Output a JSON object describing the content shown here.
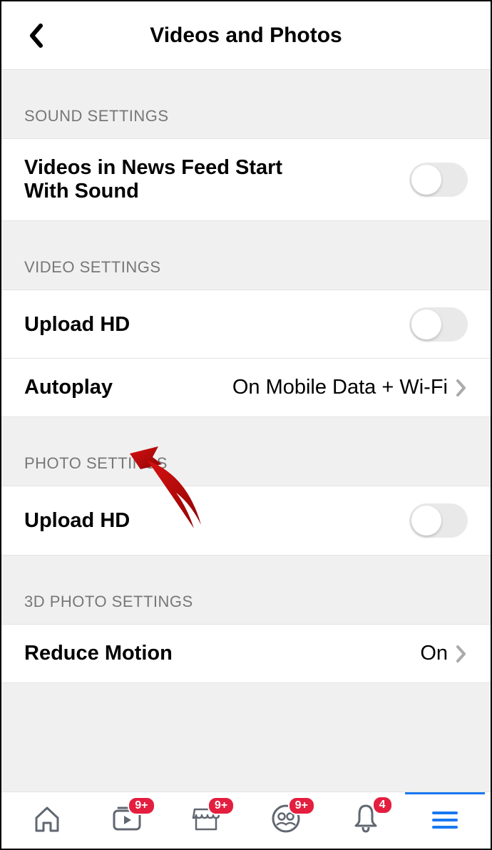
{
  "header": {
    "title": "Videos and Photos"
  },
  "sections": {
    "sound": {
      "header": "SOUND SETTINGS",
      "video_sound": {
        "label": "Videos in News Feed Start With Sound",
        "on": false
      }
    },
    "video": {
      "header": "VIDEO SETTINGS",
      "upload_hd": {
        "label": "Upload HD",
        "on": false
      },
      "autoplay": {
        "label": "Autoplay",
        "value": "On Mobile Data + Wi-Fi"
      }
    },
    "photo": {
      "header": "PHOTO SETTINGS",
      "upload_hd": {
        "label": "Upload HD",
        "on": false
      }
    },
    "three_d": {
      "header": "3D PHOTO SETTINGS",
      "reduce_motion": {
        "label": "Reduce Motion",
        "value": "On"
      }
    }
  },
  "tabbar": {
    "badges": {
      "watch": "9+",
      "marketplace": "9+",
      "groups": "9+",
      "notifications": "4"
    }
  }
}
